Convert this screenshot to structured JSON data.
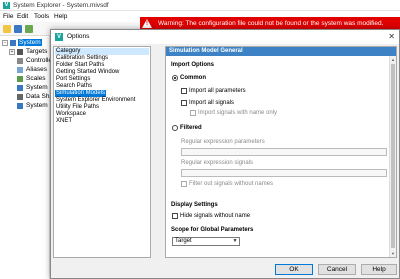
{
  "app": {
    "title": "System Explorer - System.mivsdf",
    "menu": [
      "File",
      "Edit",
      "Tools",
      "Help"
    ],
    "warning_text": "Warning: The configuration file could not be found or the system was modified.",
    "tree": [
      {
        "label": "System",
        "selected": true
      },
      {
        "label": "Targets"
      },
      {
        "label": "Controllers"
      },
      {
        "label": "Aliases"
      },
      {
        "label": "Scales"
      },
      {
        "label": "System M"
      },
      {
        "label": "Data Shar"
      },
      {
        "label": "System Im"
      }
    ]
  },
  "dialog": {
    "title": "Options",
    "close_glyph": "✕",
    "categories": [
      "Category",
      "Calibration Settings",
      "Folder Start Paths",
      "Getting Started Window",
      "Port Settings",
      "Search Paths",
      "Simulation Models",
      "System Explorer Environment",
      "Utility File Paths",
      "Workspace",
      "XNET"
    ],
    "selected_category": "Simulation Models",
    "panel": {
      "header": "Simulation Model General",
      "import_options": "Import Options",
      "common_label": "Common",
      "import_all_parameters": "Import all parameters",
      "import_all_signals": "Import all signals",
      "import_signals_name_only": "Import signals with name only",
      "filtered_label": "Filtered",
      "regex_parameters": "Regular expression parameters",
      "regex_signals": "Regular expression signals",
      "filter_out_signals": "Filter out signals without names",
      "display_settings": "Display Settings",
      "hide_signals": "Hide signals without name",
      "scope_label": "Scope for Global Parameters",
      "scope_value": "Target"
    },
    "buttons": {
      "ok": "OK",
      "cancel": "Cancel",
      "help": "Help"
    }
  },
  "colors": {
    "accent": "#0078d7",
    "header": "#3c82c4",
    "warning": "#e00000",
    "logo": "#1ba39c"
  }
}
